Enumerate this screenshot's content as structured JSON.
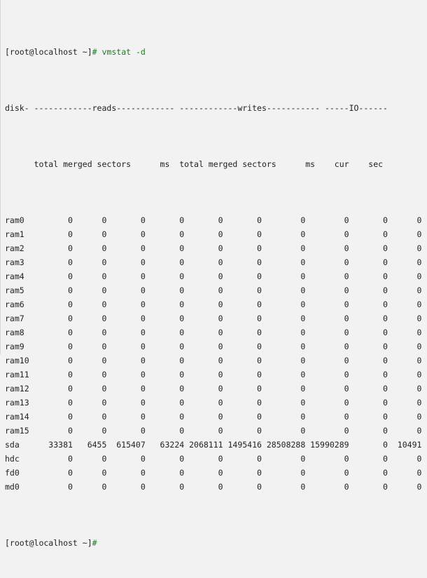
{
  "terminal": {
    "background_color": "#f2f2f2",
    "foreground_color": "#222222",
    "accent_color": "#1f7a22",
    "prompt": "[root@localhost ~]",
    "prompt_sigil": "#",
    "command": "vmstat -d"
  },
  "output": {
    "separator_line": "disk- ------------reads------------ ------------writes----------- -----IO------",
    "header_line": "      total merged sectors      ms  total merged sectors      ms    cur    sec",
    "columns": [
      "disk",
      "reads total",
      "reads merged",
      "reads sectors",
      "reads ms",
      "writes total",
      "writes merged",
      "writes sectors",
      "writes ms",
      "IO cur",
      "IO sec"
    ],
    "rows": [
      {
        "device": "ram0",
        "values": [
          "0",
          "0",
          "0",
          "0",
          "0",
          "0",
          "0",
          "0",
          "0",
          "0"
        ]
      },
      {
        "device": "ram1",
        "values": [
          "0",
          "0",
          "0",
          "0",
          "0",
          "0",
          "0",
          "0",
          "0",
          "0"
        ]
      },
      {
        "device": "ram2",
        "values": [
          "0",
          "0",
          "0",
          "0",
          "0",
          "0",
          "0",
          "0",
          "0",
          "0"
        ]
      },
      {
        "device": "ram3",
        "values": [
          "0",
          "0",
          "0",
          "0",
          "0",
          "0",
          "0",
          "0",
          "0",
          "0"
        ]
      },
      {
        "device": "ram4",
        "values": [
          "0",
          "0",
          "0",
          "0",
          "0",
          "0",
          "0",
          "0",
          "0",
          "0"
        ]
      },
      {
        "device": "ram5",
        "values": [
          "0",
          "0",
          "0",
          "0",
          "0",
          "0",
          "0",
          "0",
          "0",
          "0"
        ]
      },
      {
        "device": "ram6",
        "values": [
          "0",
          "0",
          "0",
          "0",
          "0",
          "0",
          "0",
          "0",
          "0",
          "0"
        ]
      },
      {
        "device": "ram7",
        "values": [
          "0",
          "0",
          "0",
          "0",
          "0",
          "0",
          "0",
          "0",
          "0",
          "0"
        ]
      },
      {
        "device": "ram8",
        "values": [
          "0",
          "0",
          "0",
          "0",
          "0",
          "0",
          "0",
          "0",
          "0",
          "0"
        ]
      },
      {
        "device": "ram9",
        "values": [
          "0",
          "0",
          "0",
          "0",
          "0",
          "0",
          "0",
          "0",
          "0",
          "0"
        ]
      },
      {
        "device": "ram10",
        "values": [
          "0",
          "0",
          "0",
          "0",
          "0",
          "0",
          "0",
          "0",
          "0",
          "0"
        ]
      },
      {
        "device": "ram11",
        "values": [
          "0",
          "0",
          "0",
          "0",
          "0",
          "0",
          "0",
          "0",
          "0",
          "0"
        ]
      },
      {
        "device": "ram12",
        "values": [
          "0",
          "0",
          "0",
          "0",
          "0",
          "0",
          "0",
          "0",
          "0",
          "0"
        ]
      },
      {
        "device": "ram13",
        "values": [
          "0",
          "0",
          "0",
          "0",
          "0",
          "0",
          "0",
          "0",
          "0",
          "0"
        ]
      },
      {
        "device": "ram14",
        "values": [
          "0",
          "0",
          "0",
          "0",
          "0",
          "0",
          "0",
          "0",
          "0",
          "0"
        ]
      },
      {
        "device": "ram15",
        "values": [
          "0",
          "0",
          "0",
          "0",
          "0",
          "0",
          "0",
          "0",
          "0",
          "0"
        ]
      },
      {
        "device": "sda",
        "values": [
          "33381",
          "6455",
          "615407",
          "63224",
          "2068111",
          "1495416",
          "28508288",
          "15990289",
          "0",
          "10491"
        ]
      },
      {
        "device": "hdc",
        "values": [
          "0",
          "0",
          "0",
          "0",
          "0",
          "0",
          "0",
          "0",
          "0",
          "0"
        ]
      },
      {
        "device": "fd0",
        "values": [
          "0",
          "0",
          "0",
          "0",
          "0",
          "0",
          "0",
          "0",
          "0",
          "0"
        ]
      },
      {
        "device": "md0",
        "values": [
          "0",
          "0",
          "0",
          "0",
          "0",
          "0",
          "0",
          "0",
          "0",
          "0"
        ]
      }
    ]
  }
}
